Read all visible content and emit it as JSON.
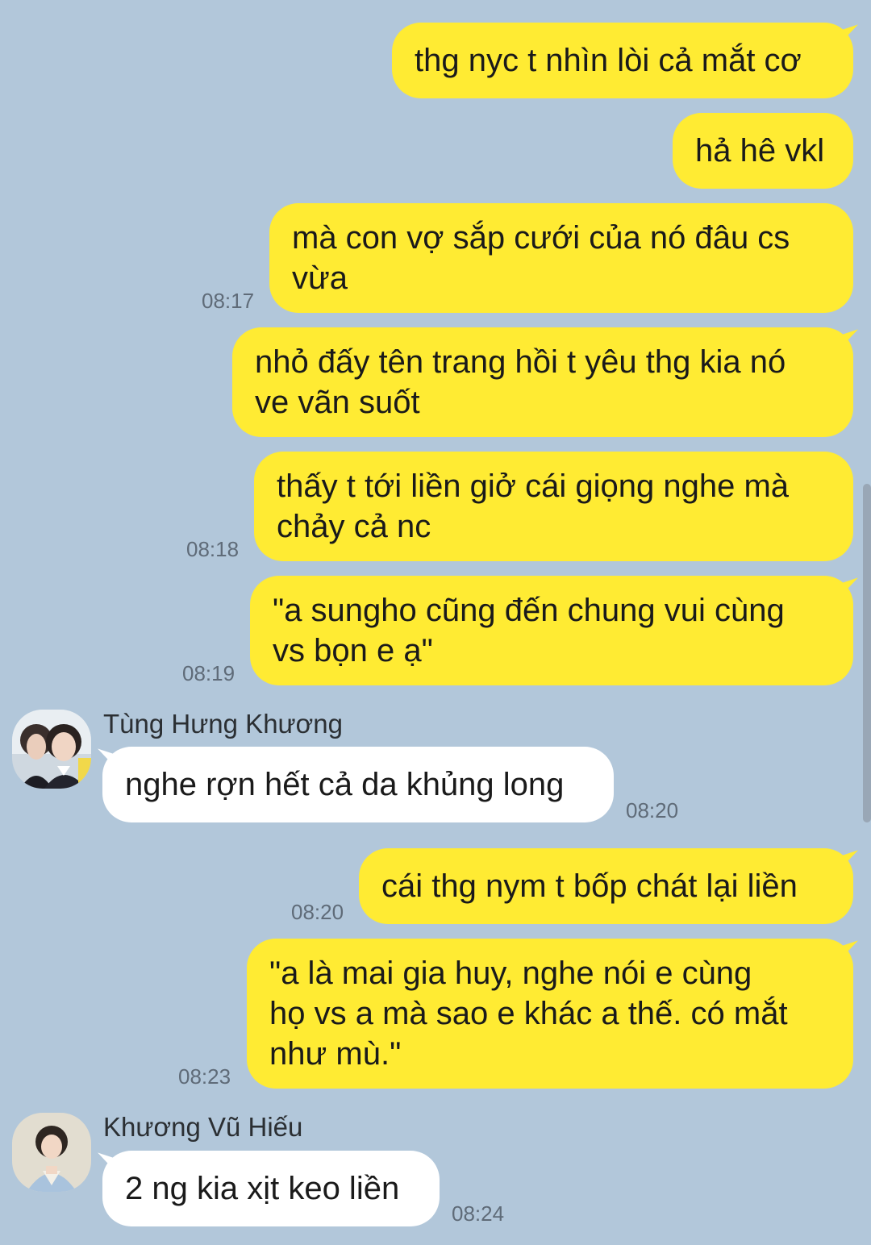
{
  "colors": {
    "background": "#b2c7da",
    "outgoing_bubble": "#ffeb33",
    "incoming_bubble": "#ffffff",
    "time_text": "#5f6b78"
  },
  "messages": {
    "m1": {
      "text": "thg nyc t nhìn lòi cả mắt cơ"
    },
    "m2": {
      "text": "hả hê vkl"
    },
    "m3": {
      "text": "mà con vợ sắp cưới của nó đâu cs\nvừa",
      "time": "08:17"
    },
    "m4": {
      "text": "nhỏ đấy tên trang hồi t yêu thg kia nó\nve vãn suốt"
    },
    "m5": {
      "text": "thấy t tới liền giở cái giọng nghe mà\nchảy cả nc",
      "time": "08:18"
    },
    "m6": {
      "text": "\"a sungho cũng đến chung vui cùng\nvs bọn e ạ\"",
      "time": "08:19"
    },
    "m7": {
      "sender": "Tùng Hưng Khương",
      "text": "nghe rợn hết cả da khủng long",
      "time": "08:20",
      "avatar_icon": "profile-photo-icon"
    },
    "m8": {
      "text": "cái thg nym t bốp chát lại liền",
      "time": "08:20"
    },
    "m9": {
      "text": "\"a là mai gia huy, nghe nói e cùng\nhọ vs a mà sao e khác a thế. có mắt\nnhư mù.\"",
      "time": "08:23"
    },
    "m10": {
      "sender": "Khương Vũ Hiếu",
      "text": "2 ng kia xịt keo liền",
      "time": "08:24",
      "avatar_icon": "profile-photo-icon"
    }
  }
}
